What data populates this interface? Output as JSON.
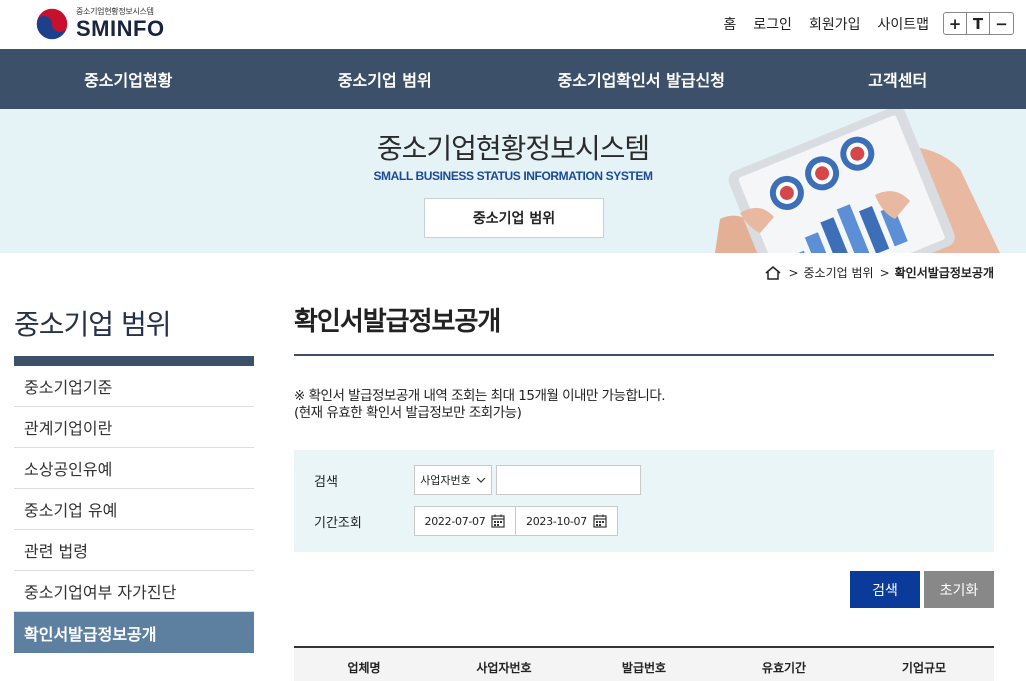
{
  "header": {
    "logo_sub": "중소기업현황정보시스템",
    "logo_main": "SMINFO",
    "links": [
      "홈",
      "로그인",
      "회원가입",
      "사이트맵"
    ],
    "font_controls": [
      "+",
      "T",
      "−"
    ]
  },
  "nav": [
    "중소기업현황",
    "중소기업 범위",
    "중소기업확인서 발급신청",
    "고객센터"
  ],
  "banner": {
    "title": "중소기업현황정보시스템",
    "subtitle": "SMALL BUSINESS STATUS INFORMATION SYSTEM",
    "button": "중소기업 범위"
  },
  "breadcrumb": {
    "items": [
      "중소기업 범위",
      "확인서발급정보공개"
    ]
  },
  "sidebar": {
    "title": "중소기업 범위",
    "items": [
      "중소기업기준",
      "관계기업이란",
      "소상공인유예",
      "중소기업 유예",
      "관련 법령",
      "중소기업여부 자가진단",
      "확인서발급정보공개"
    ],
    "active_index": 6
  },
  "main": {
    "title": "확인서발급정보공개",
    "notice_line1": "※ 확인서 발급정보공개 내역 조회는 최대 15개월 이내만 가능합니다.",
    "notice_line2": "(현재 유효한 확인서 발급정보만 조회가능)",
    "search": {
      "label": "검색",
      "select_value": "사업자번호",
      "input_value": ""
    },
    "period": {
      "label": "기간조회",
      "start": "2022-07-07",
      "end": "2023-10-07"
    },
    "buttons": {
      "search": "검색",
      "reset": "초기화"
    },
    "table_headers": [
      "업체명",
      "사업자번호",
      "발급번호",
      "유효기간",
      "기업규모"
    ]
  },
  "colors": {
    "nav_bg": "#3d5069",
    "banner_bg": "#e6f3f6",
    "active_side": "#5d7fa0",
    "search_btn": "#0a3a9a",
    "reset_btn": "#888888"
  }
}
